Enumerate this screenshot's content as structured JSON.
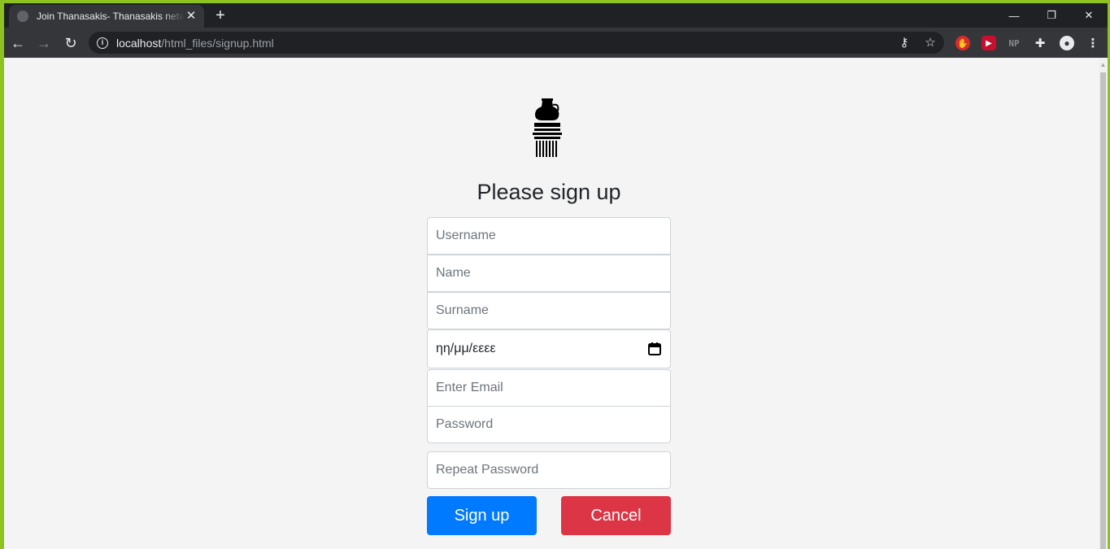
{
  "browser": {
    "tab_title": "Join Thanasakis- Thanasakis network",
    "tab_close": "✕",
    "new_tab": "+",
    "window_controls": {
      "minimize": "—",
      "restore": "❐",
      "close": "✕"
    },
    "nav": {
      "back": "←",
      "forward": "→",
      "reload": "↻"
    },
    "url_host": "localhost",
    "url_path": "/html_files/signup.html",
    "info_glyph": "i",
    "key_glyph": "⚷",
    "star_glyph": "☆",
    "extensions": {
      "ext1": "✋",
      "ext2": "▶",
      "ext3": "NP",
      "puzzle": "✚",
      "profile": "●",
      "menu": "⋮"
    }
  },
  "page": {
    "heading": "Please sign up",
    "form": {
      "username_placeholder": "Username",
      "name_placeholder": "Name",
      "surname_placeholder": "Surname",
      "birthdate_value": "ηη/μμ/εεεε",
      "email_placeholder": "Enter Email",
      "password_placeholder": "Password",
      "repeat_password_placeholder": "Repeat Password"
    },
    "buttons": {
      "signup": "Sign up",
      "cancel": "Cancel"
    }
  },
  "colors": {
    "primary": "#007bff",
    "danger": "#dc3545",
    "page_bg": "#f4f4f4",
    "desktop_accent": "#8dc21f"
  }
}
